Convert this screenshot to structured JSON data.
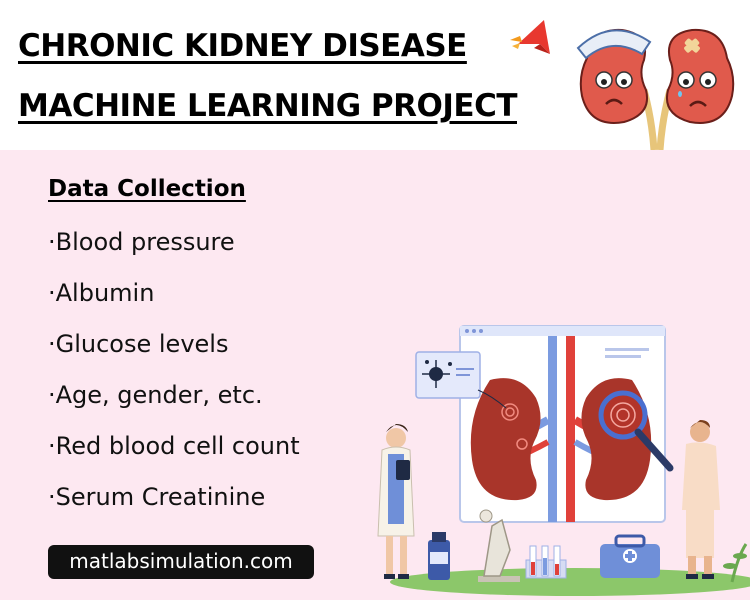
{
  "header": {
    "title_line1": "CHRONIC KIDNEY DISEASE",
    "title_line2": "MACHINE LEARNING PROJECT"
  },
  "section": {
    "title": "Data Collection",
    "items": [
      "·Blood pressure",
      "·Albumin",
      "·Glucose levels",
      "·Age, gender, etc.",
      "·Red blood cell count",
      "·Serum Creatinine"
    ]
  },
  "footer": {
    "url": "matlabsimulation.com"
  },
  "icons": {
    "logo": "red-orange-arrow-logo",
    "header_art": "sick-kidneys-cartoon",
    "illustration": "kidney-diagnosis-lab-illustration"
  },
  "colors": {
    "background": "#fde8f1",
    "header_bg": "#ffffff",
    "kidney": "#a9352a",
    "accent_red": "#e53935",
    "accent_blue": "#5b7fd6",
    "pill": "#111111"
  }
}
